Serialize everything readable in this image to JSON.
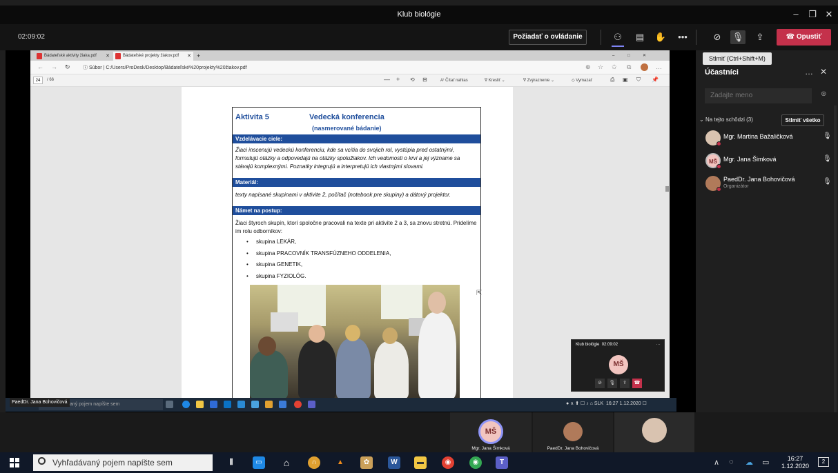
{
  "window": {
    "title": "Klub biológie"
  },
  "meeting": {
    "timer": "02:09:02",
    "request_control": "Požiadať o ovládanie",
    "leave_label": "Opustiť",
    "mic_tooltip": "Stlmiť (Ctrl+Shift+M)"
  },
  "browser": {
    "tabs": [
      {
        "label": "Bádateľské aktivity žiaka.pdf"
      },
      {
        "label": "Bádateľské projekty žiakov.pdf"
      }
    ],
    "address_prefix": "Súbor",
    "address": "C:/Users/ProDesk/Desktop/Bádateľské%20projekty%20žiakov.pdf",
    "page_current": "24",
    "page_total": "/ 66",
    "toolbar": {
      "read_aloud": "Čítať nahlas",
      "draw": "Kresliť",
      "highlight": "Zvýraznenie",
      "erase": "Vymazať"
    }
  },
  "document": {
    "activity": "Aktivita 5",
    "title": "Vedecká konferencia",
    "subtitle": "(nasmerované bádanie)",
    "goals_header": "Vzdelávacie ciele:",
    "goals_text": "Žiaci inscenujú vedeckú konferenciu, kde sa vcítia do svojich rol, vystúpia pred ostatnými, formulujú otázky a odpovedajú na otázky spolužiakov. Ich vedomosti o krvi a jej význame sa stávajú komplexnými. Poznatky integrujú a interpretujú ich vlastnými slovami.",
    "material_header": "Materiál:",
    "material_text": "texty napísané skupinami v aktivite 2, počítač (notebook pre skupiny) a dátový projektor.",
    "procedure_header": "Námet na postup:",
    "procedure_text": "Žiaci štyroch skupín, ktorí spoločne pracovali na texte pri aktivite 2 a 3, sa znovu stretnú. Pridelíme im rolu odborníkov:",
    "groups": [
      "skupina LEKÁR,",
      "skupina PRACOVNÍK TRANSFÚZNEHO ODDELENIA,",
      "skupina GENETIK,",
      "skupina FYZIOLÓG."
    ]
  },
  "inner_taskbar": {
    "share_label": "PaedDr. Jana Bohovičová",
    "search_placeholder": "Vyhľadávaný pojem napíšte sem",
    "lang": "SLK",
    "time": "16:27",
    "date": "1.12.2020"
  },
  "mini_window": {
    "title": "Klub biológie",
    "timer": "02:09:02",
    "initials": "MŠ"
  },
  "participants": {
    "title": "Účastníci",
    "search_placeholder": "Zadajte meno",
    "section": "Na tejto schôdzi (3)",
    "mute_all": "Stlmiť všetko",
    "list": [
      {
        "name": "Mgr. Martina Bažaličková",
        "role": ""
      },
      {
        "name": "Mgr. Jana Šimková",
        "role": "",
        "initials": "MŠ"
      },
      {
        "name": "PaedDr. Jana Bohovičová",
        "role": "Organizátor"
      }
    ]
  },
  "video_strip": {
    "tiles": [
      {
        "name": "Mgr. Jana Šimková",
        "initials": "MŠ"
      },
      {
        "name": "PaedDr. Jana Bohovičová"
      },
      {
        "name": ""
      }
    ]
  },
  "taskbar": {
    "search_placeholder": "Vyhľadávaný pojem napíšte sem",
    "time": "16:27",
    "date": "1.12.2020",
    "notifications": "2"
  },
  "colors": {
    "leave": "#c4314b",
    "doc_blue": "#1f4e9c",
    "teams_bg": "#1f1f1f"
  }
}
